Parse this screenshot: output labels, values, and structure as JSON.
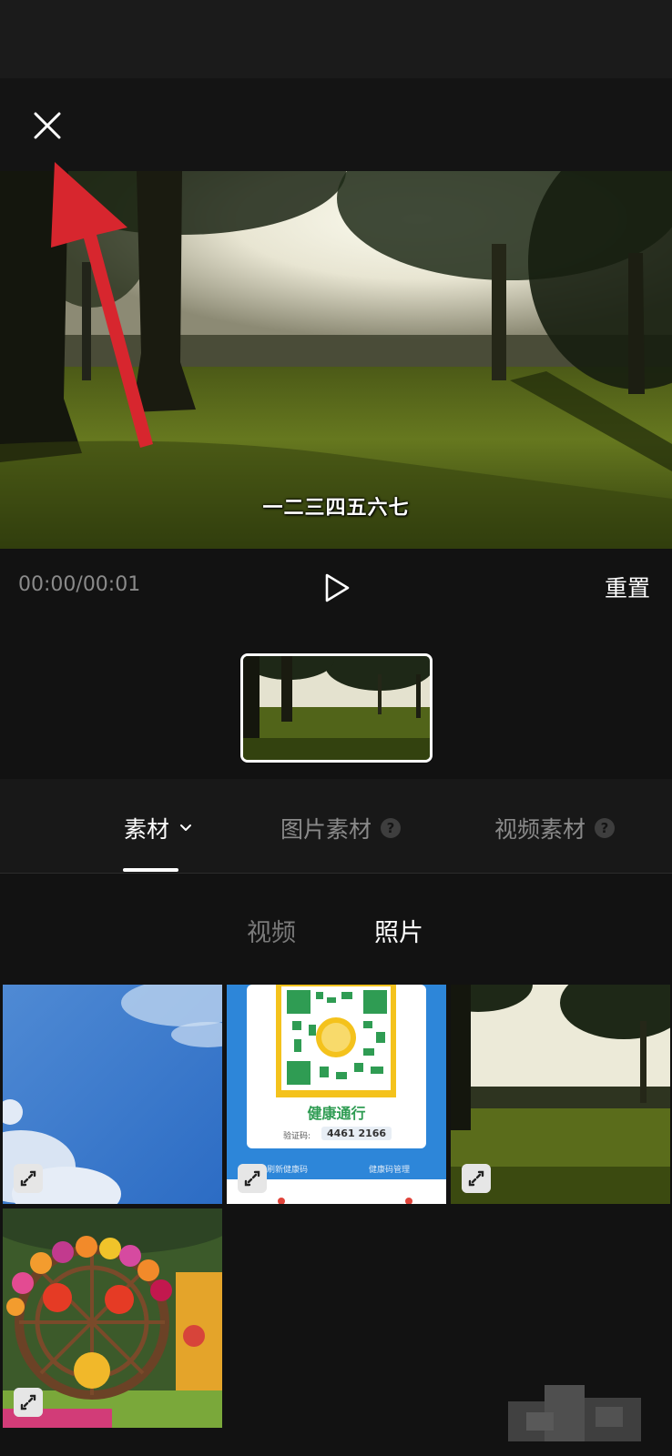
{
  "preview": {
    "subtitle": "一二三四五六七"
  },
  "controls": {
    "time": "00:00/00:01",
    "reset_label": "重置"
  },
  "tabs": [
    {
      "label": "素材",
      "active": true
    },
    {
      "label": "图片素材",
      "help": "?"
    },
    {
      "label": "视频素材",
      "help": "?"
    }
  ],
  "subtabs": [
    {
      "label": "视频",
      "active": false
    },
    {
      "label": "照片",
      "active": true
    }
  ],
  "grid": {
    "qr_card": {
      "title": "健康通行",
      "code_label": "验证码:",
      "code": "4461 2166",
      "link_left": "刷新健康码",
      "link_right": "健康码管理"
    }
  },
  "colors": {
    "accent_white": "#ffffff",
    "muted": "#8a8a8a",
    "annotation_red": "#d7262e",
    "background": "#121212"
  }
}
